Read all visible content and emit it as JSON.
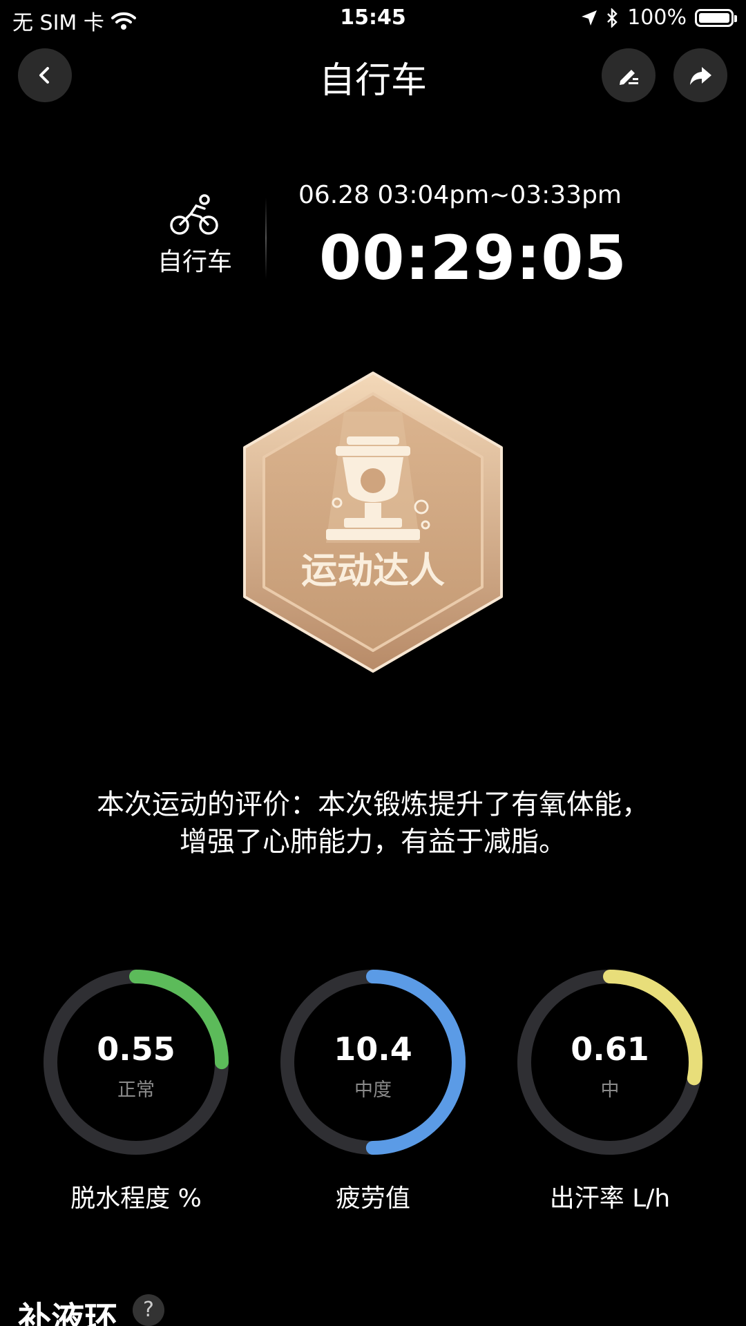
{
  "status_bar": {
    "carrier": "无 SIM 卡",
    "time": "15:45",
    "battery": "100%",
    "battery_level": 1.0,
    "icons": [
      "wifi-icon",
      "location-icon",
      "bluetooth-icon",
      "battery-icon"
    ]
  },
  "nav": {
    "title": "自行车",
    "back_icon": "chevron-left-icon",
    "edit_icon": "edit-icon",
    "share_icon": "share-icon"
  },
  "workout": {
    "sport_icon": "bicycle-icon",
    "sport_label": "自行车",
    "time_range": "06.28 03:04pm~03:33pm",
    "duration": "00:29:05"
  },
  "badge": {
    "icon": "trophy-badge-icon",
    "label": "运动达人"
  },
  "evaluation": {
    "line1": "本次运动的评价：本次锻炼提升了有氧体能，",
    "line2": "增强了心肺能力，有益于减脂。"
  },
  "metrics": [
    {
      "value": "0.55",
      "level": "正常",
      "caption": "脱水程度 %",
      "fraction": 0.25,
      "color": "#5cbb5a"
    },
    {
      "value": "10.4",
      "level": "中度",
      "caption": "疲劳值",
      "fraction": 0.5,
      "color": "#5b9be6"
    },
    {
      "value": "0.61",
      "level": "中",
      "caption": "出汗率 L/h",
      "fraction": 0.28,
      "color": "#e8de7a"
    }
  ],
  "bottom": {
    "title": "补液环",
    "help": "?"
  }
}
